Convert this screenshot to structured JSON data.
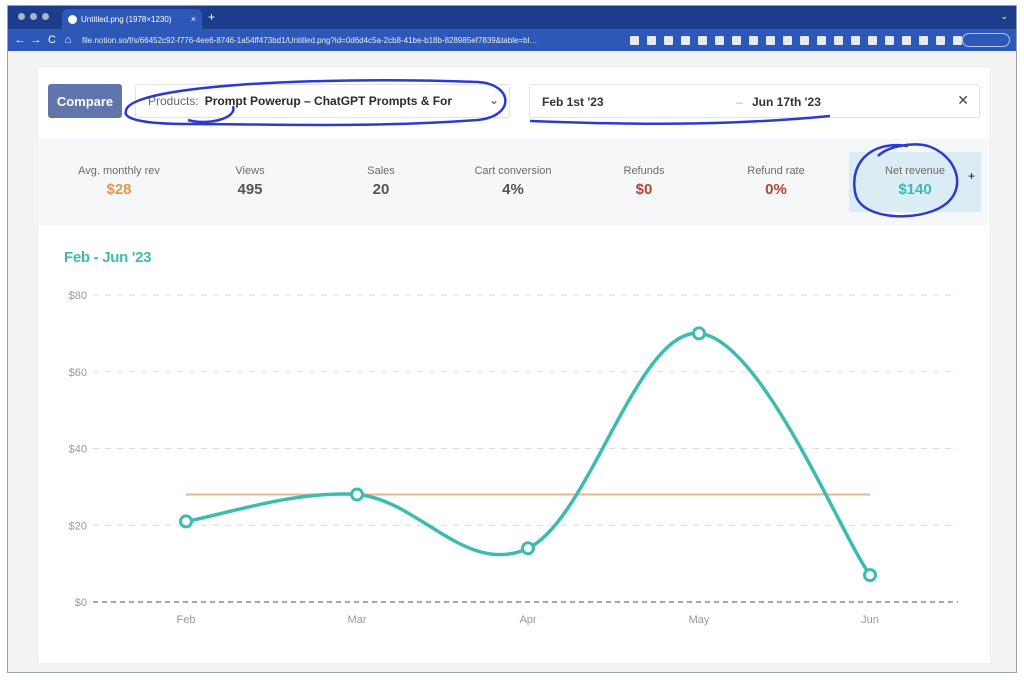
{
  "browser": {
    "tab_title": "Untitled.png (1978×1230)",
    "tab_close": "×",
    "new_tab": "+",
    "tab_menu": "⌄",
    "nav_back": "←",
    "nav_forward": "→",
    "nav_reload": "C",
    "nav_home": "⌂",
    "url": "file.notion.so/f/s/66452c92-f776-4ee6-8746-1a54ff473bd1/Untitled.png?id=0d6d4c5a-2cb8-41be-b18b-828985ef7839&table=bl…"
  },
  "toolbar": {
    "compare_label": "Compare",
    "products_label": "Products:",
    "products_value": "Prompt Powerup – ChatGPT Prompts & For",
    "products_chevron": "⌄",
    "date_from": "Feb 1st '23",
    "date_sep": "–",
    "date_to": "Jun 17th '23",
    "clear_icon": "✕"
  },
  "stats": [
    {
      "label": "Avg. monthly rev",
      "value": "$28",
      "color": "#e3954a"
    },
    {
      "label": "Views",
      "value": "495",
      "color": "#555555"
    },
    {
      "label": "Sales",
      "value": "20",
      "color": "#555555"
    },
    {
      "label": "Cart conversion",
      "value": "4%",
      "color": "#555555"
    },
    {
      "label": "Refunds",
      "value": "$0",
      "color": "#b5432f"
    },
    {
      "label": "Refund rate",
      "value": "0%",
      "color": "#b5432f"
    },
    {
      "label": "Net revenue",
      "value": "$140",
      "color": "#3cbcb0"
    }
  ],
  "stats_add": "+",
  "chart_data": {
    "type": "line",
    "title": "Feb - Jun '23",
    "categories": [
      "Feb",
      "Mar",
      "Apr",
      "May",
      "Jun"
    ],
    "series": [
      {
        "values": [
          21,
          28,
          14,
          70,
          7
        ],
        "color": "#3cbcb0"
      }
    ],
    "average_line": {
      "value": 28,
      "color": "#eab788"
    },
    "ylim": [
      0,
      80
    ],
    "yticks": [
      "$0",
      "$20",
      "$40",
      "$60",
      "$80"
    ],
    "ytick_values": [
      0,
      20,
      40,
      60,
      80
    ],
    "grid": true
  },
  "colors": {
    "accent": "#3cbcb0",
    "compare_button": "#6175ad",
    "annotation_ink": "#2a3bd1"
  }
}
